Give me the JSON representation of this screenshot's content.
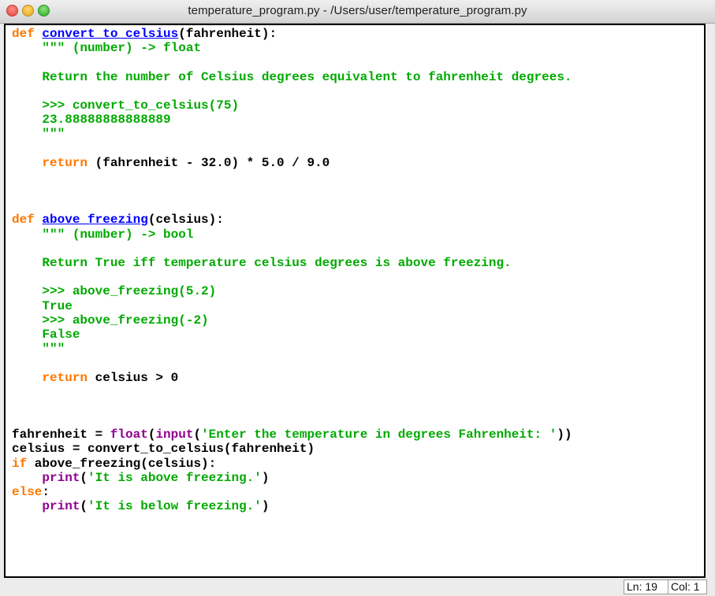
{
  "window": {
    "title": "temperature_program.py - /Users/user/temperature_program.py"
  },
  "editor": {
    "lines": [
      [
        [
          "k",
          "def"
        ],
        [
          "p",
          " "
        ],
        [
          "f",
          "convert_to_celsius"
        ],
        [
          "p",
          "(fahrenheit):"
        ]
      ],
      [
        [
          "p",
          "    "
        ],
        [
          "s",
          "\"\"\" (number) -> float"
        ]
      ],
      [
        [
          "s",
          ""
        ]
      ],
      [
        [
          "s",
          "    Return the number of Celsius degrees equivalent to fahrenheit degrees."
        ]
      ],
      [
        [
          "s",
          ""
        ]
      ],
      [
        [
          "s",
          "    >>> convert_to_celsius(75)"
        ]
      ],
      [
        [
          "s",
          "    23.88888888888889"
        ]
      ],
      [
        [
          "s",
          "    \"\"\""
        ]
      ],
      [
        [
          "p",
          ""
        ]
      ],
      [
        [
          "p",
          "    "
        ],
        [
          "k",
          "return"
        ],
        [
          "p",
          " (fahrenheit - 32.0) * 5.0 / 9.0"
        ]
      ],
      [
        [
          "p",
          ""
        ]
      ],
      [
        [
          "p",
          ""
        ]
      ],
      [
        [
          "p",
          ""
        ]
      ],
      [
        [
          "k",
          "def"
        ],
        [
          "p",
          " "
        ],
        [
          "f",
          "above_freezing"
        ],
        [
          "p",
          "(celsius):"
        ]
      ],
      [
        [
          "p",
          "    "
        ],
        [
          "s",
          "\"\"\" (number) -> bool"
        ]
      ],
      [
        [
          "s",
          ""
        ]
      ],
      [
        [
          "s",
          "    Return True iff temperature celsius degrees is above freezing."
        ]
      ],
      [
        [
          "s",
          ""
        ]
      ],
      [
        [
          "s",
          "    >>> above_freezing(5.2)"
        ]
      ],
      [
        [
          "s",
          "    True"
        ]
      ],
      [
        [
          "s",
          "    >>> above_freezing(-2)"
        ]
      ],
      [
        [
          "s",
          "    False"
        ]
      ],
      [
        [
          "s",
          "    \"\"\""
        ]
      ],
      [
        [
          "p",
          ""
        ]
      ],
      [
        [
          "p",
          "    "
        ],
        [
          "k",
          "return"
        ],
        [
          "p",
          " celsius > 0"
        ]
      ],
      [
        [
          "p",
          ""
        ]
      ],
      [
        [
          "p",
          ""
        ]
      ],
      [
        [
          "p",
          ""
        ]
      ],
      [
        [
          "p",
          "fahrenheit = "
        ],
        [
          "b",
          "float"
        ],
        [
          "p",
          "("
        ],
        [
          "b",
          "input"
        ],
        [
          "p",
          "("
        ],
        [
          "s",
          "'Enter the temperature in degrees Fahrenheit: '"
        ],
        [
          "p",
          "))"
        ]
      ],
      [
        [
          "p",
          "celsius = convert_to_celsius(fahrenheit)"
        ]
      ],
      [
        [
          "k",
          "if"
        ],
        [
          "p",
          " above_freezing(celsius):"
        ]
      ],
      [
        [
          "p",
          "    "
        ],
        [
          "b",
          "print"
        ],
        [
          "p",
          "("
        ],
        [
          "s",
          "'It is above freezing.'"
        ],
        [
          "p",
          ")"
        ]
      ],
      [
        [
          "k",
          "else"
        ],
        [
          "p",
          ":"
        ]
      ],
      [
        [
          "p",
          "    "
        ],
        [
          "b",
          "print"
        ],
        [
          "p",
          "("
        ],
        [
          "s",
          "'It is below freezing.'"
        ],
        [
          "p",
          ")"
        ]
      ]
    ]
  },
  "status": {
    "line": "Ln: 19",
    "column": "Col: 1"
  },
  "colors": {
    "keyword": "#ff7700",
    "definition": "#0000ff",
    "builtin": "#900090",
    "string": "#00aa00",
    "text": "#000000"
  }
}
